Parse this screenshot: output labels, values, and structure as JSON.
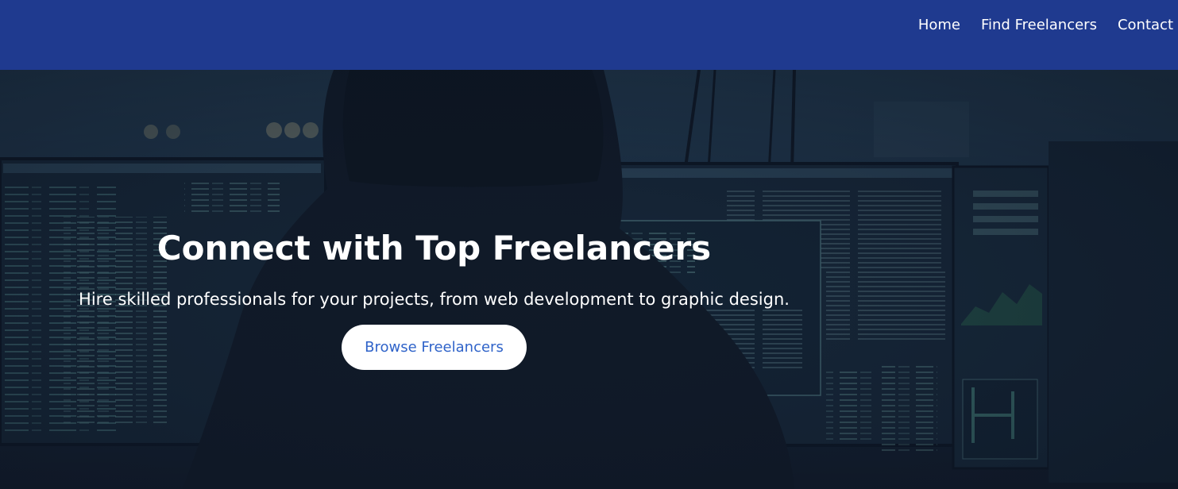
{
  "header": {
    "nav": [
      {
        "label": "Home"
      },
      {
        "label": "Find Freelancers"
      },
      {
        "label": "Contact"
      }
    ]
  },
  "hero": {
    "title": "Connect with Top Freelancers",
    "subtitle": "Hire skilled professionals for your projects, from web development to graphic design.",
    "cta_label": "Browse Freelancers",
    "background_icon": "hooded-figure-at-monitors"
  },
  "colors": {
    "header_bg": "#1f3a8f",
    "hero_overlay": "#0f1a2b",
    "cta_text": "#2f63c9",
    "monitor_text": "#7fc6c1"
  }
}
